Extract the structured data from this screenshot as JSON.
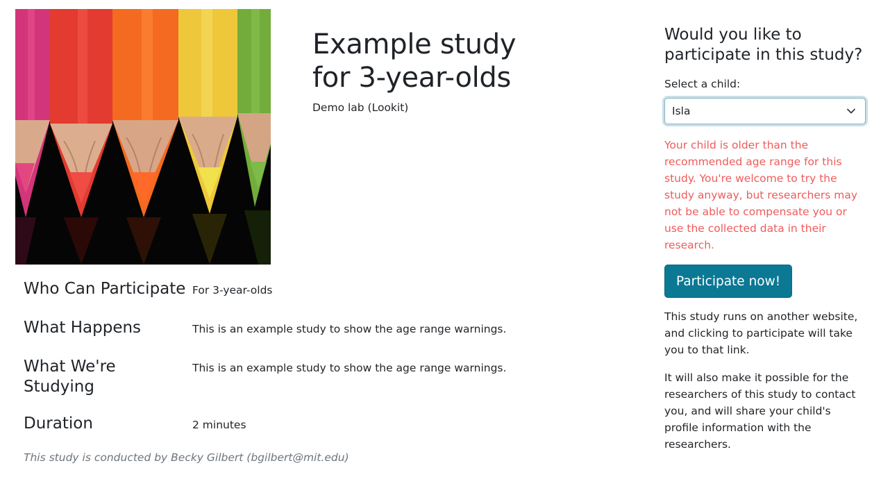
{
  "study": {
    "title_line1": "Example study",
    "title_line2": "for 3-year-olds",
    "lab": "Demo lab (Lookit)",
    "image_icon": "colored-pencils-image"
  },
  "details": [
    {
      "label": "Who Can Participate",
      "value": "For 3-year-olds"
    },
    {
      "label": "What Happens",
      "value": "This is an example study to show the age range warnings."
    },
    {
      "label_line1": "What We're",
      "label_line2": "Studying",
      "value": "This is an example study to show the age range warnings."
    },
    {
      "label": "Duration",
      "value": "2 minutes"
    }
  ],
  "credit": "This study is conducted by Becky Gilbert (bgilbert@mit.edu)",
  "sidebar": {
    "question_line1": "Would you like to",
    "question_line2": "participate in this study?",
    "select_label": "Select a child:",
    "selected_child": "Isla",
    "age_warning": "Your child is older than the recommended age range for this study. You're welcome to try the study anyway, but researchers may not be able to compensate you or use the collected data in their research.",
    "participate_button": "Participate now!",
    "info_1": "This study runs on another website, and clicking to participate will take you to that link.",
    "info_2": "It will also make it possible for the researchers of this study to contact you, and will share your child's profile information with the researchers."
  },
  "colors": {
    "button": "#0b7894",
    "warning": "#ef5b5b",
    "credit": "#6c757d"
  }
}
